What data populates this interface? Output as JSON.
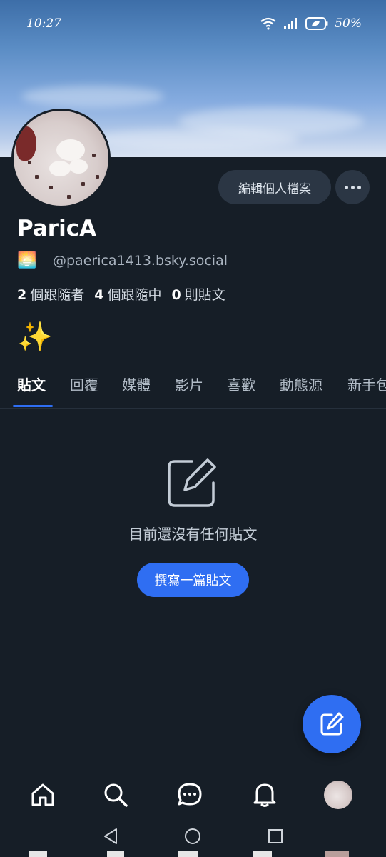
{
  "status_bar": {
    "time": "10:27",
    "battery": "50%"
  },
  "profile": {
    "display_name": "ParicA",
    "handle_emoji": "🌅",
    "handle": "@paerica1413.bsky.social",
    "followers_count": "2",
    "followers_label": "個跟隨者",
    "following_count": "4",
    "following_label": "個跟隨中",
    "posts_count": "0",
    "posts_label": "則貼文",
    "bio": "✨"
  },
  "actions": {
    "edit_profile": "編輯個人檔案"
  },
  "tabs": [
    {
      "label": "貼文",
      "active": true
    },
    {
      "label": "回覆",
      "active": false
    },
    {
      "label": "媒體",
      "active": false
    },
    {
      "label": "影片",
      "active": false
    },
    {
      "label": "喜歡",
      "active": false
    },
    {
      "label": "動態源",
      "active": false
    },
    {
      "label": "新手包",
      "active": false
    }
  ],
  "empty_state": {
    "message": "目前還沒有任何貼文",
    "button": "撰寫一篇貼文"
  },
  "bottom_nav": [
    "home-icon",
    "search-icon",
    "chat-icon",
    "bell-icon",
    "profile-avatar"
  ],
  "colors": {
    "background": "#161e27",
    "accent": "#2f6ef2",
    "chip": "#2b3644"
  }
}
